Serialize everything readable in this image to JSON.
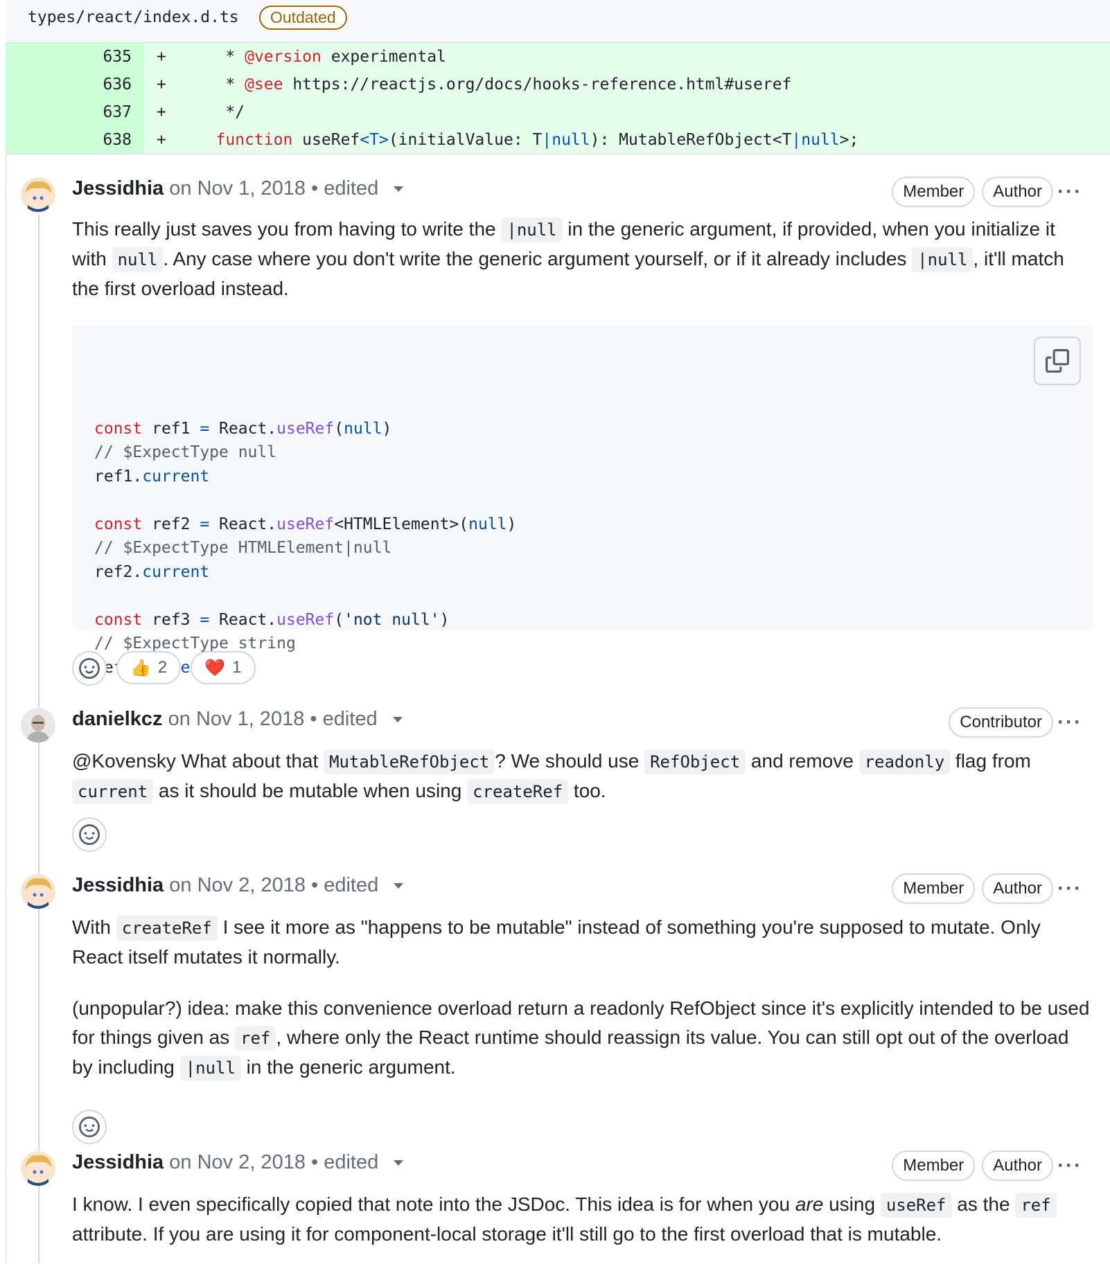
{
  "file": {
    "path": "types/react/index.d.ts",
    "badge": "Outdated"
  },
  "diff": [
    {
      "num": "635",
      "sign": "+",
      "parts": [
        [
          "plain",
          "    * "
        ],
        [
          "kw",
          "@version"
        ],
        [
          "plain",
          " experimental"
        ]
      ]
    },
    {
      "num": "636",
      "sign": "+",
      "parts": [
        [
          "plain",
          "    * "
        ],
        [
          "kw",
          "@see"
        ],
        [
          "plain",
          " https://reactjs.org/docs/hooks-reference.html#useref"
        ]
      ]
    },
    {
      "num": "637",
      "sign": "+",
      "parts": [
        [
          "plain",
          "    */"
        ]
      ]
    },
    {
      "num": "638",
      "sign": "+",
      "parts": [
        [
          "plain",
          "   "
        ],
        [
          "kw",
          "function"
        ],
        [
          "plain",
          " useRef"
        ],
        [
          "blue",
          "<T>"
        ],
        [
          "plain",
          "(initialValue: T"
        ],
        [
          "blue",
          "|null"
        ],
        [
          "plain",
          "): MutableRefObject<T"
        ],
        [
          "blue",
          "|null"
        ],
        [
          "plain",
          ">;"
        ]
      ]
    }
  ],
  "comments": [
    {
      "author": "Jessidhia",
      "date": "on Nov 1, 2018",
      "edited": "edited",
      "badges": [
        "Member",
        "Author"
      ],
      "paragraph": [
        [
          "t",
          "This really just saves you from having to write the "
        ],
        [
          "c",
          "|null"
        ],
        [
          "t",
          " in the generic argument, if provided, when you initialize it with "
        ],
        [
          "c",
          "null"
        ],
        [
          "t",
          ". Any case where you don't write the generic argument yourself, or if it already includes "
        ],
        [
          "c",
          "|null"
        ],
        [
          "t",
          ", it'll match the first overload instead."
        ]
      ],
      "code_lines": [
        [
          [
            "kw",
            "const"
          ],
          [
            "p",
            " ref1 "
          ],
          [
            "blue",
            "="
          ],
          [
            "p",
            " React."
          ],
          [
            "purple",
            "useRef"
          ],
          [
            "p",
            "("
          ],
          [
            "blue",
            "null"
          ],
          [
            "p",
            ")"
          ]
        ],
        [
          [
            "cmt",
            "// $ExpectType null"
          ]
        ],
        [
          [
            "p",
            "ref1."
          ],
          [
            "blue",
            "current"
          ]
        ],
        [],
        [
          [
            "kw",
            "const"
          ],
          [
            "p",
            " ref2 "
          ],
          [
            "blue",
            "="
          ],
          [
            "p",
            " React."
          ],
          [
            "purple",
            "useRef"
          ],
          [
            "p",
            "<HTMLElement>("
          ],
          [
            "blue",
            "null"
          ],
          [
            "p",
            ")"
          ]
        ],
        [
          [
            "cmt",
            "// $ExpectType HTMLElement|null"
          ]
        ],
        [
          [
            "p",
            "ref2."
          ],
          [
            "blue",
            "current"
          ]
        ],
        [],
        [
          [
            "kw",
            "const"
          ],
          [
            "p",
            " ref3 "
          ],
          [
            "blue",
            "="
          ],
          [
            "p",
            " React."
          ],
          [
            "purple",
            "useRef"
          ],
          [
            "p",
            "("
          ],
          [
            "str",
            "'not null'"
          ],
          [
            "p",
            ")"
          ]
        ],
        [
          [
            "cmt",
            "// $ExpectType string"
          ]
        ],
        [
          [
            "p",
            "ref3."
          ],
          [
            "blue",
            "current"
          ]
        ]
      ],
      "reactions": [
        {
          "emoji": "👍",
          "count": "2"
        },
        {
          "emoji": "❤️",
          "count": "1"
        }
      ]
    },
    {
      "author": "danielkcz",
      "date": "on Nov 1, 2018",
      "edited": "edited",
      "badges": [
        "Contributor"
      ],
      "paragraph": [
        [
          "t",
          "@Kovensky What about that "
        ],
        [
          "c",
          "MutableRefObject"
        ],
        [
          "t",
          "? We should use "
        ],
        [
          "c",
          "RefObject"
        ],
        [
          "t",
          " and remove "
        ],
        [
          "c",
          "readonly"
        ],
        [
          "t",
          " flag from "
        ],
        [
          "c",
          "current"
        ],
        [
          "t",
          " as it should be mutable when using "
        ],
        [
          "c",
          "createRef"
        ],
        [
          "t",
          " too."
        ]
      ]
    },
    {
      "author": "Jessidhia",
      "date": "on Nov 2, 2018",
      "edited": "edited",
      "badges": [
        "Member",
        "Author"
      ],
      "paragraph": [
        [
          "t",
          "With "
        ],
        [
          "c",
          "createRef"
        ],
        [
          "t",
          " I see it more as \"happens to be mutable\" instead of something you're supposed to mutate. Only React itself mutates it normally."
        ]
      ],
      "paragraph2": [
        [
          "t",
          "(unpopular?) idea: make this convenience overload return a readonly RefObject since it's explicitly intended to be used for things given as "
        ],
        [
          "c",
          "ref"
        ],
        [
          "t",
          ", where only the React runtime should reassign its value. You can still opt out of the overload by including "
        ],
        [
          "c",
          "|null"
        ],
        [
          "t",
          " in the generic argument."
        ]
      ]
    },
    {
      "author": "Jessidhia",
      "date": "on Nov 2, 2018",
      "edited": "edited",
      "badges": [
        "Member",
        "Author"
      ],
      "paragraph": [
        [
          "t",
          "I know. I even specifically copied that note into the JSDoc. This idea is for when you "
        ],
        [
          "i",
          "are"
        ],
        [
          "t",
          " using "
        ],
        [
          "c",
          "useRef"
        ],
        [
          "t",
          " as the "
        ],
        [
          "c",
          "ref"
        ],
        [
          "t",
          " attribute. If you are using it for component-local storage it'll still go to the first overload that is mutable."
        ]
      ]
    }
  ],
  "icons": {
    "copy": "copy-icon",
    "smiley": "smiley-icon",
    "kebab": "kebab-horizontal-icon",
    "caret": "triangle-down-icon"
  },
  "colors": {
    "diff_added_bg": "#e6ffec",
    "diff_added_num_bg": "#ccffd8",
    "outdated": "#9a6700",
    "keyword": "#cf222e"
  }
}
